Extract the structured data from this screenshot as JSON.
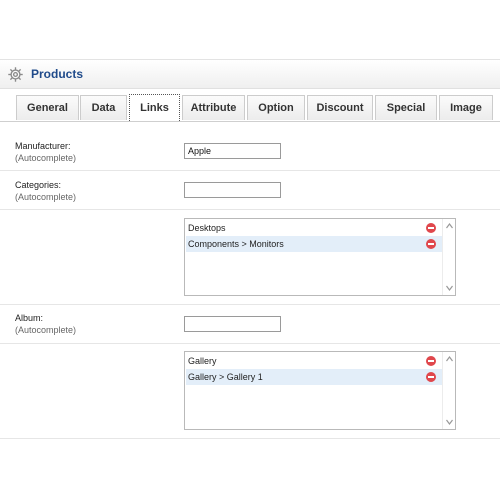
{
  "header": {
    "title": "Products"
  },
  "tabs": [
    {
      "label": "General"
    },
    {
      "label": "Data"
    },
    {
      "label": "Links"
    },
    {
      "label": "Attribute"
    },
    {
      "label": "Option"
    },
    {
      "label": "Discount"
    },
    {
      "label": "Special"
    },
    {
      "label": "Image"
    }
  ],
  "active_tab": "Links",
  "form": {
    "manufacturer": {
      "label": "Manufacturer:",
      "hint": "(Autocomplete)",
      "value": "Apple"
    },
    "categories": {
      "label": "Categories:",
      "hint": "(Autocomplete)",
      "value": "",
      "items": [
        {
          "name": "Desktops"
        },
        {
          "name": "Components > Monitors"
        }
      ]
    },
    "album": {
      "label": "Album:",
      "hint": "(Autocomplete)",
      "value": "",
      "items": [
        {
          "name": "Gallery"
        },
        {
          "name": "Gallery > Gallery 1"
        }
      ]
    }
  },
  "colors": {
    "title": "#1f4a8a",
    "remove": "#e0474c",
    "alt_row": "#e3eef9"
  }
}
